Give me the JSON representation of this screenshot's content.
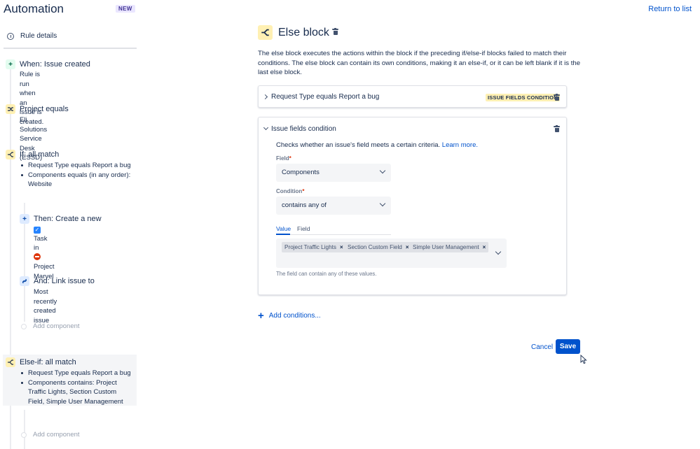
{
  "header": {
    "title": "Automation",
    "badge": "NEW",
    "return_link": "Return to list"
  },
  "sidebar": {
    "rule_details": "Rule details",
    "nodes": [
      {
        "title": "When: Issue created",
        "subtitle": "Rule is run when an issue is created."
      },
      {
        "title": "Project equals",
        "subtitle": "Eli Solutions Service Desk (ESSD)"
      },
      {
        "title": "If: all match",
        "bullets": [
          "Request Type equals Report a bug",
          "Components equals (in any order): Website"
        ]
      },
      {
        "title": "Then: Create a new",
        "issue_type": "Task",
        "connector": "in",
        "project": "Project Marvel"
      },
      {
        "title": "And: Link issue to",
        "subtitle": "Most recently created issue"
      },
      {
        "title": "Else-if: all match",
        "bullets": [
          "Request Type equals Report a bug",
          "Components contains: Project Traffic Lights, Section Custom Field, Simple User Management"
        ]
      }
    ],
    "add_component": "Add component"
  },
  "main": {
    "title": "Else block",
    "description": "The else block executes the actions within the block if the preceding if/else-if blocks failed to match their conditions. The else block can contain its own conditions, making it an else-if, or it can be left blank if it is the last else block.",
    "collapsed_condition": {
      "title": "Request Type equals Report a bug",
      "lozenge": "ISSUE FIELDS CONDITION"
    },
    "expanded_condition": {
      "title": "Issue fields condition",
      "helper": "Checks whether an issue's field meets a certain criteria.",
      "learn_more": "Learn more.",
      "field_label": "Field",
      "field_value": "Components",
      "condition_label": "Condition",
      "condition_value": "contains any of",
      "tabs": [
        "Value",
        "Field"
      ],
      "tags": [
        "Project Traffic Lights",
        "Section Custom Field",
        "Simple User Management"
      ],
      "hint": "The field can contain any of these values."
    },
    "add_conditions": "Add conditions...",
    "cancel": "Cancel",
    "save": "Save"
  },
  "colors": {
    "primary": "#0052cc",
    "condition_yellow": "#fff0b3",
    "trigger_green": "#e3fcef",
    "action_blue": "#deebff"
  }
}
